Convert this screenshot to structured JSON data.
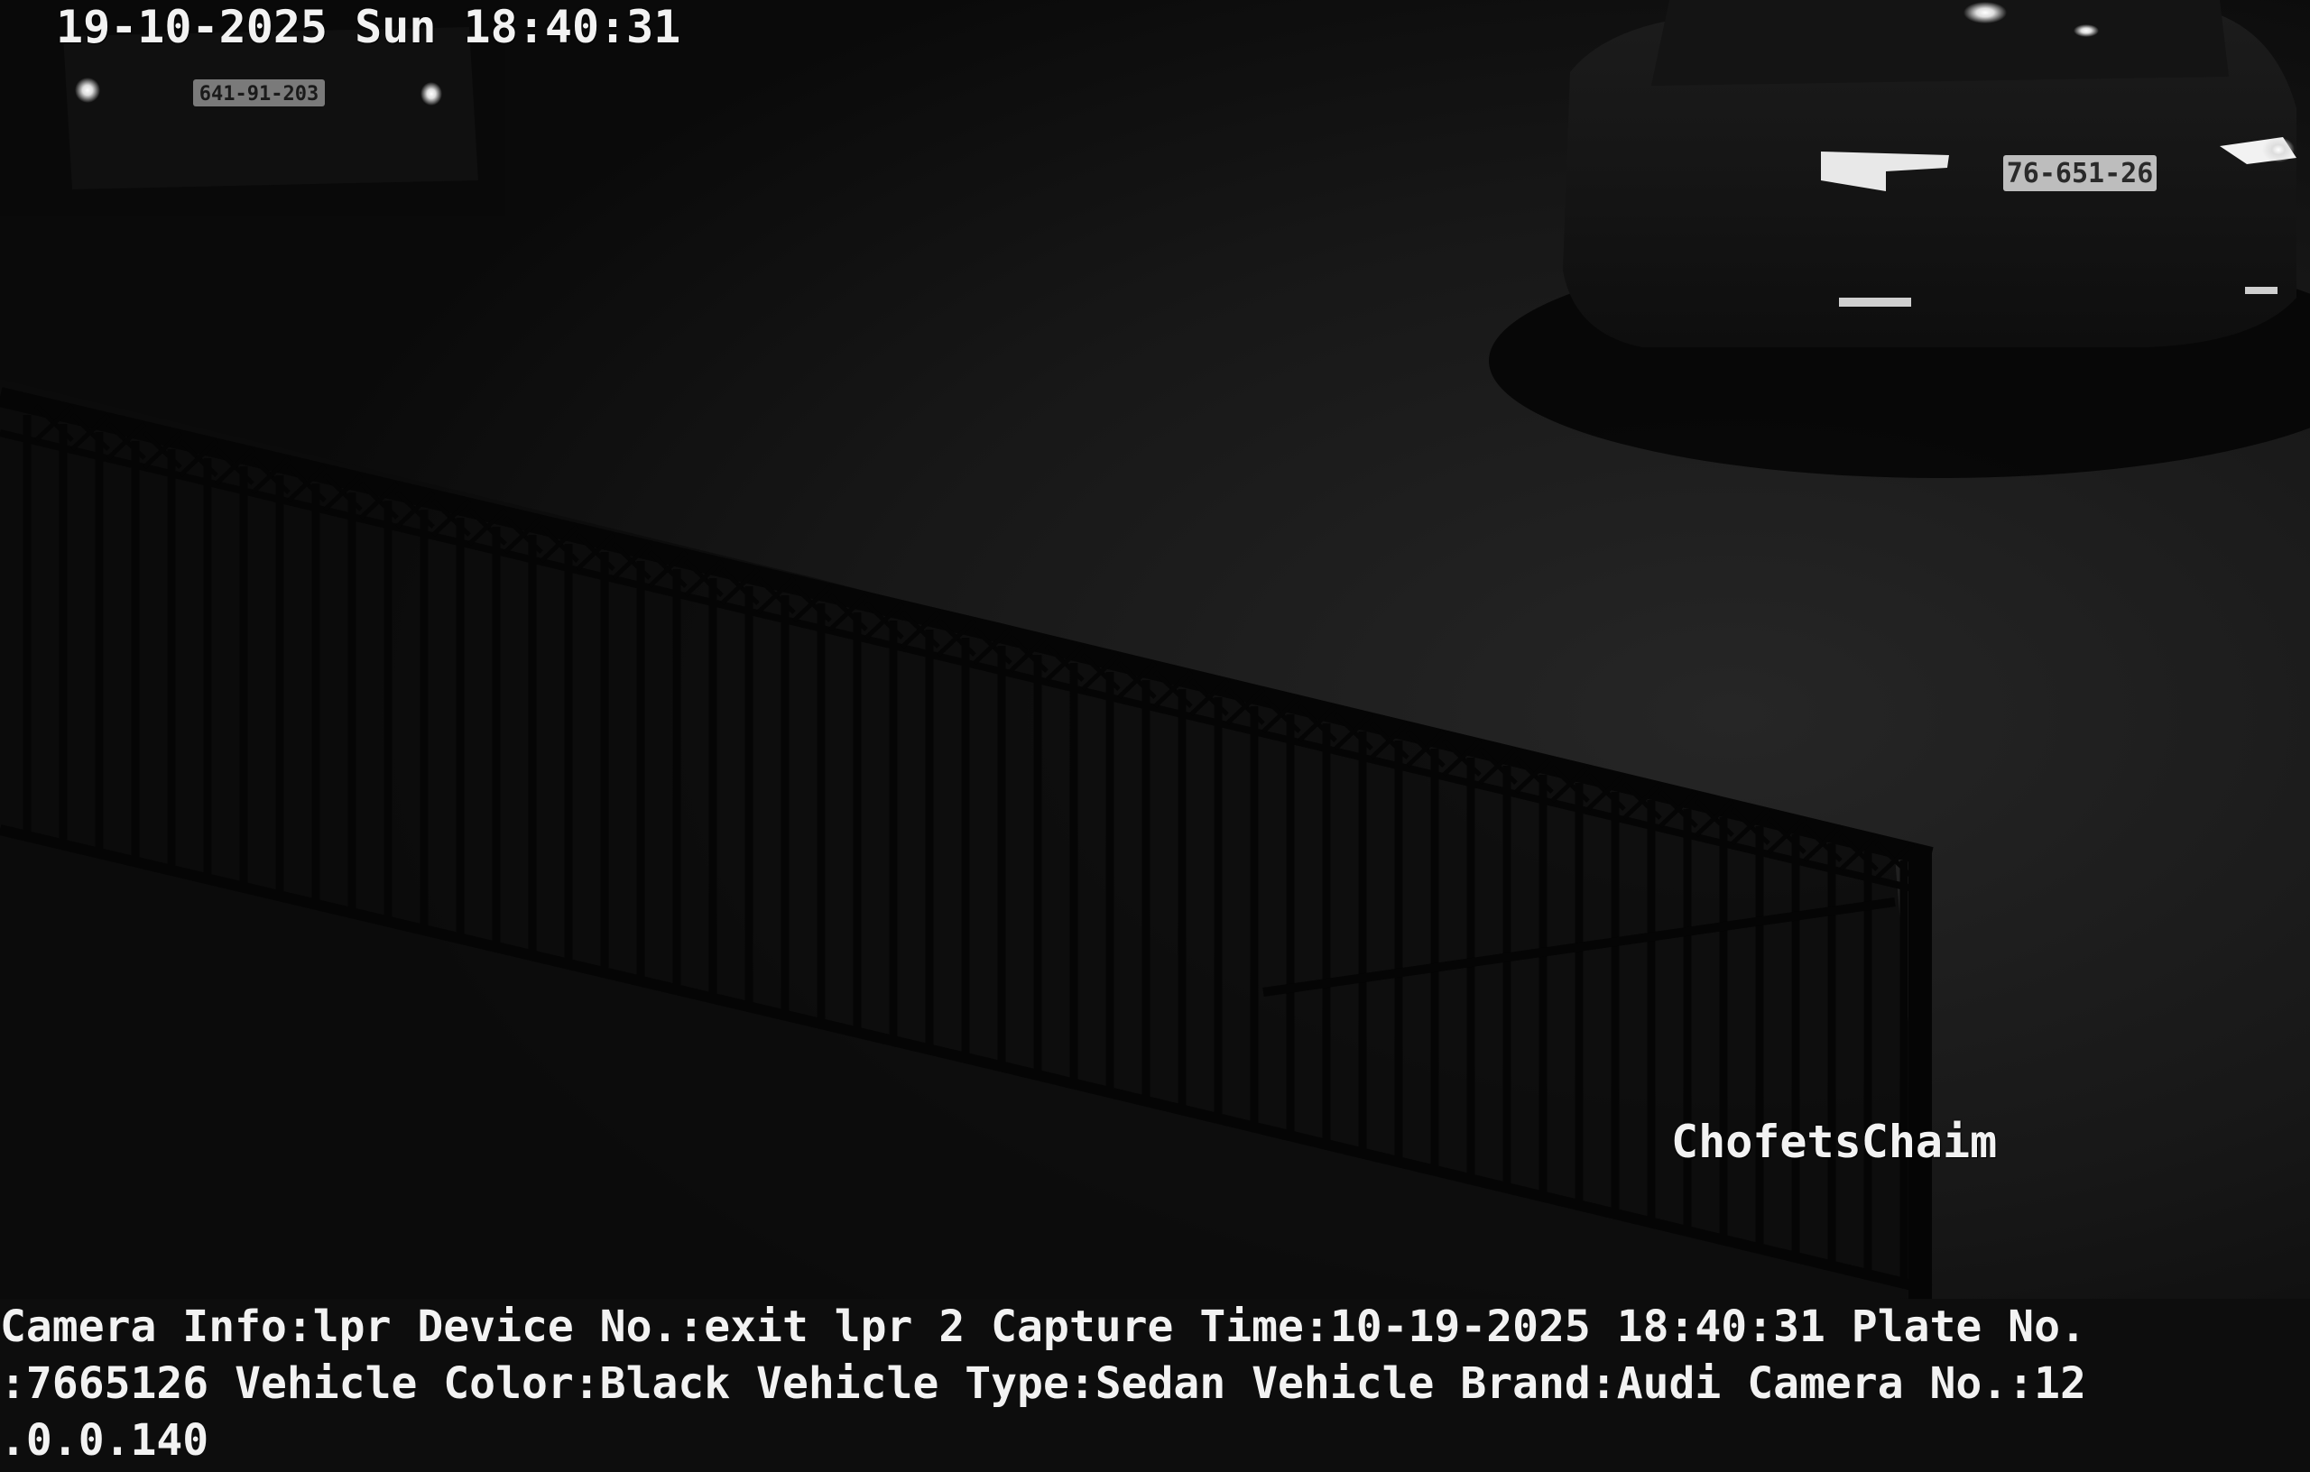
{
  "osd": {
    "timestamp": "19-10-2025 Sun 18:40:31",
    "site_label": "ChofetsChaim"
  },
  "vehicles": {
    "left_plate": "641-91-203",
    "right_plate": "76-651-26"
  },
  "info_bar": {
    "line1": "Camera Info:lpr Device No.:exit lpr 2 Capture Time:10-19-2025 18:40:31 Plate No.",
    "line2": ":7665126 Vehicle Color:Black Vehicle Type:Sedan Vehicle Brand:Audi Camera No.:12",
    "line3": ".0.0.140"
  }
}
